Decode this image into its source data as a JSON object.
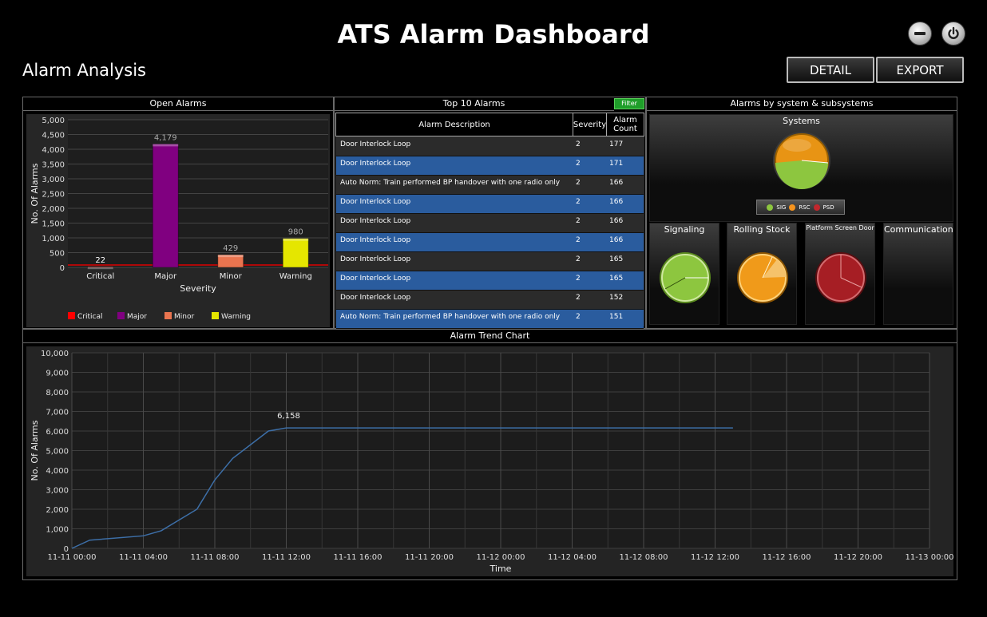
{
  "header": {
    "title": "ATS Alarm Dashboard",
    "section": "Alarm Analysis",
    "detail_label": "DETAIL",
    "export_label": "EXPORT",
    "minimize_icon": "minus-circle-icon",
    "power_icon": "power-icon"
  },
  "panels": {
    "open_alarms": "Open Alarms",
    "top10": "Top 10 Alarms",
    "filter": "Filter",
    "systems_panel": "Alarms by system & subsystems",
    "trend": "Alarm Trend Chart"
  },
  "table": {
    "headers": [
      "Alarm Description",
      "Severity",
      "Alarm Count"
    ],
    "rows": [
      {
        "desc": "Door Interlock Loop",
        "sev": "2",
        "count": "177"
      },
      {
        "desc": "Door Interlock Loop",
        "sev": "2",
        "count": "171"
      },
      {
        "desc": "Auto Norm: Train performed BP handover with one radio only",
        "sev": "2",
        "count": "166"
      },
      {
        "desc": "Door Interlock Loop",
        "sev": "2",
        "count": "166"
      },
      {
        "desc": "Door Interlock Loop",
        "sev": "2",
        "count": "166"
      },
      {
        "desc": "Door Interlock Loop",
        "sev": "2",
        "count": "166"
      },
      {
        "desc": "Door Interlock Loop",
        "sev": "2",
        "count": "165"
      },
      {
        "desc": "Door Interlock Loop",
        "sev": "2",
        "count": "165"
      },
      {
        "desc": "Door Interlock Loop",
        "sev": "2",
        "count": "152"
      },
      {
        "desc": "Auto Norm: Train performed BP handover with one radio only",
        "sev": "2",
        "count": "151"
      }
    ]
  },
  "systems": {
    "title": "Systems",
    "legend": [
      {
        "label": "SIG",
        "color": "#8dc63f"
      },
      {
        "label": "RSC",
        "color": "#f7941d"
      },
      {
        "label": "PSD",
        "color": "#c1272d"
      }
    ],
    "tiles": [
      {
        "label": "Signaling",
        "color": "#8dc63f"
      },
      {
        "label": "Rolling Stock",
        "color": "#f7941d"
      },
      {
        "label": "Platform Screen Door",
        "color": "#c1272d"
      },
      {
        "label": "Communication",
        "color": ""
      }
    ]
  },
  "chart_data": [
    {
      "type": "bar",
      "title": "",
      "xlabel": "Severity",
      "ylabel": "No. Of Alarms",
      "categories": [
        "Critical",
        "Major",
        "Minor",
        "Warning"
      ],
      "values": [
        22,
        4179,
        429,
        980
      ],
      "value_labels": [
        "22",
        "4,179",
        "429",
        "980"
      ],
      "colors": [
        "#ff0000",
        "#800080",
        "#e9744f",
        "#e5e600"
      ],
      "ylim": [
        0,
        5000
      ],
      "yticks": [
        "0",
        "500",
        "1,000",
        "1,500",
        "2,000",
        "2,500",
        "3,000",
        "3,500",
        "4,000",
        "4,500",
        "5,000"
      ],
      "legend": [
        "Critical",
        "Major",
        "Minor",
        "Warning"
      ],
      "legend_position": "bottom",
      "grid": true
    },
    {
      "type": "line",
      "title": "",
      "xlabel": "Time",
      "ylabel": "No. Of Alarms",
      "ylim": [
        0,
        10000
      ],
      "yticks": [
        "0",
        "1,000",
        "2,000",
        "3,000",
        "4,000",
        "5,000",
        "6,000",
        "7,000",
        "8,000",
        "9,000",
        "10,000"
      ],
      "xticks": [
        "11-11 00:00",
        "11-11 04:00",
        "11-11 08:00",
        "11-11 12:00",
        "11-11 16:00",
        "11-11 20:00",
        "11-12 00:00",
        "11-12 04:00",
        "11-12 08:00",
        "11-12 12:00",
        "11-12 16:00",
        "11-12 20:00",
        "11-13 00:00"
      ],
      "x_hours_max": 48,
      "points": [
        {
          "x": "11-11 00:00",
          "h": 0,
          "y": 0
        },
        {
          "x": "11-11 01:00",
          "h": 1,
          "y": 420
        },
        {
          "x": "11-11 04:00",
          "h": 4,
          "y": 640
        },
        {
          "x": "11-11 05:00",
          "h": 5,
          "y": 900
        },
        {
          "x": "11-11 07:00",
          "h": 7,
          "y": 2000
        },
        {
          "x": "11-11 08:00",
          "h": 8,
          "y": 3500
        },
        {
          "x": "11-11 09:00",
          "h": 9,
          "y": 4600
        },
        {
          "x": "11-11 11:00",
          "h": 11,
          "y": 6000
        },
        {
          "x": "11-11 12:00",
          "h": 12,
          "y": 6158
        },
        {
          "x": "11-12 13:00",
          "h": 37,
          "y": 6158
        }
      ],
      "annotation": "6,158",
      "grid": true
    }
  ]
}
